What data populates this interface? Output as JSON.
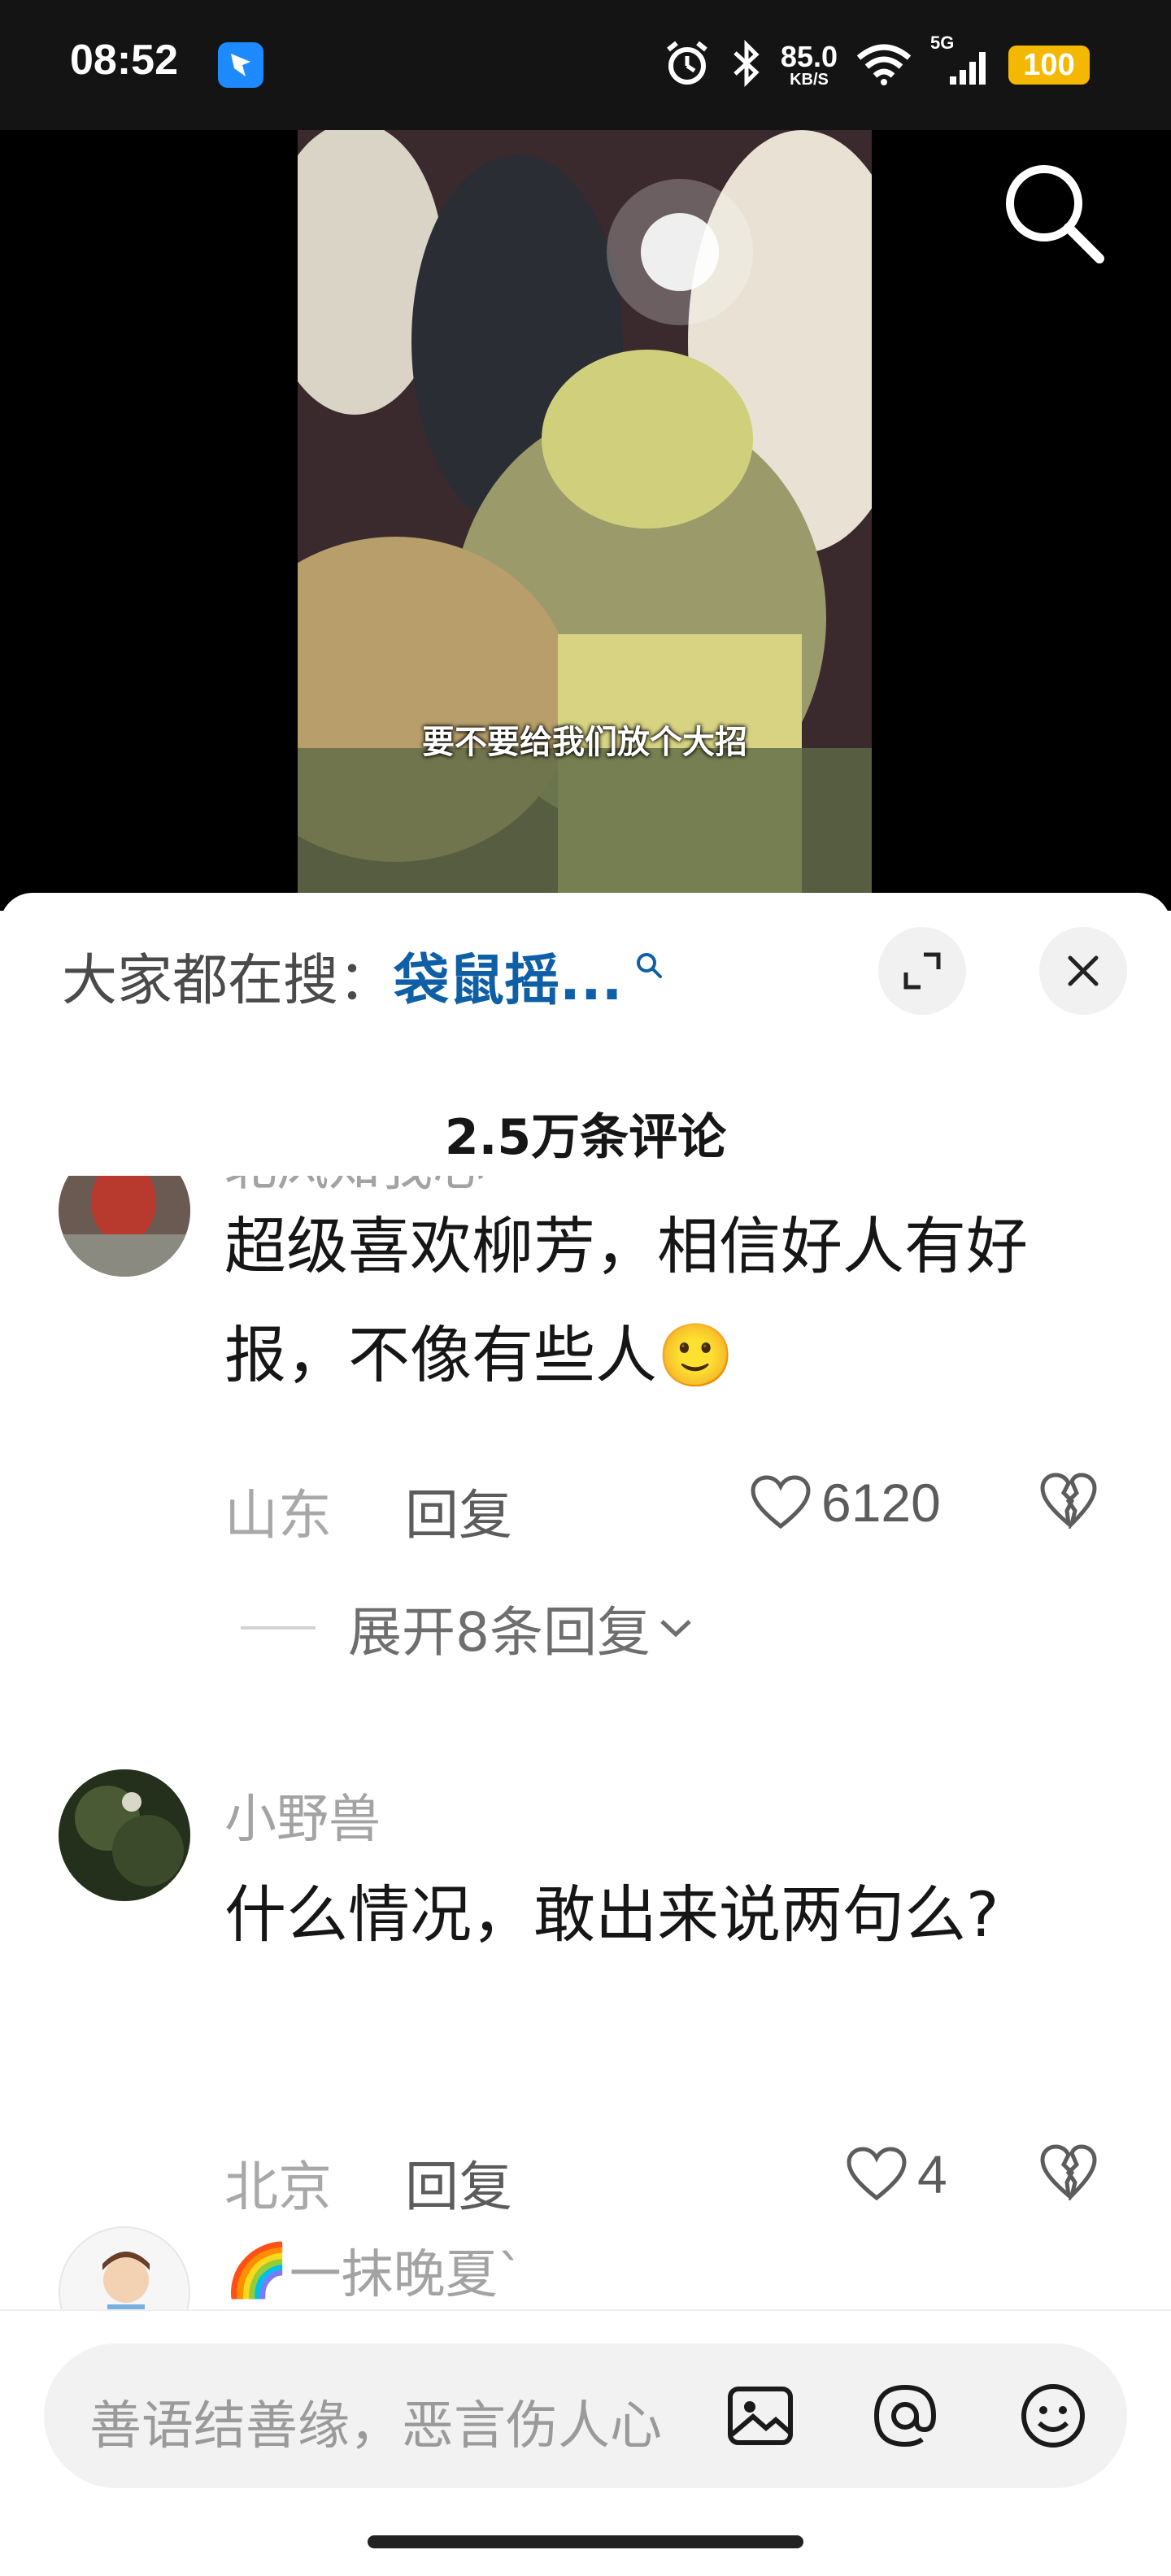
{
  "status_bar": {
    "time": "08:52",
    "network_speed": "85.0",
    "network_unit": "KB/S",
    "network_type": "5G",
    "battery": "100"
  },
  "video": {
    "subtitle": "要不要给我们放个大招"
  },
  "sheet": {
    "search_prefix": "大家都在搜：",
    "search_term": "袋鼠摇...",
    "comment_count": "2.5万条评论"
  },
  "comments": [
    {
      "username": "北风知我心",
      "text": "超级喜欢柳芳，相信好人有好报，不像有些人",
      "emoji": "🙂",
      "location": "山东",
      "reply_label": "回复",
      "likes": "6120",
      "expand_replies": "展开8条回复"
    },
    {
      "username": "小野兽",
      "text": "什么情况，敢出来说两句么?",
      "location": "北京",
      "reply_label": "回复",
      "likes": "4"
    },
    {
      "username_prefix": "🌈",
      "username": "一抹晚夏`"
    }
  ],
  "input": {
    "placeholder": "善语结善缘，恶言伤人心"
  },
  "colors": {
    "link_blue": "#0f5fa6",
    "battery_yellow": "#f5b800",
    "app_icon_blue": "#1d8bff"
  }
}
